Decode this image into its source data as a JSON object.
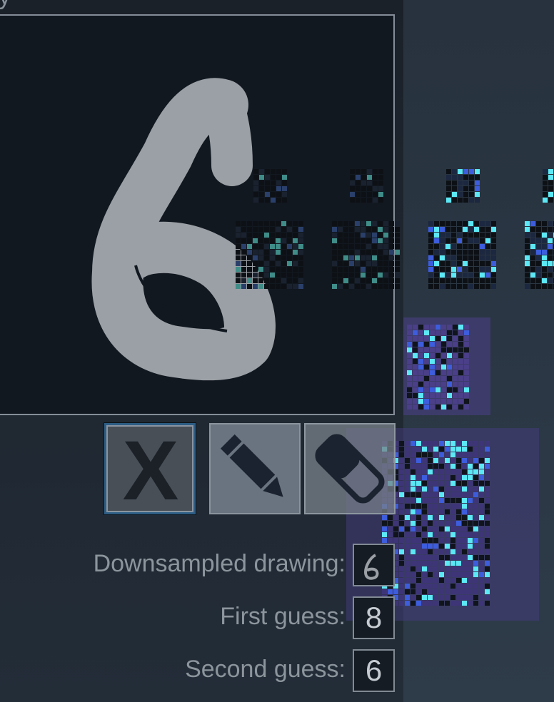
{
  "header": {
    "title_fragment": "y"
  },
  "canvas": {
    "drawn_digit": "6"
  },
  "tools": {
    "clear_label": "X",
    "pencil": "pencil-icon",
    "eraser": "eraser-icon"
  },
  "results": {
    "downsampled_label": "Downsampled drawing:",
    "first_guess_label": "First guess:",
    "first_guess_value": "8",
    "second_guess_label": "Second guess:",
    "second_guess_value": "6"
  },
  "colors": {
    "stroke": "#9ba0a6",
    "accent_cyan": "#5ce8f4",
    "accent_blue": "#3d5ddc",
    "teal": "#3f8c88",
    "purple_panel": "#4a3f88"
  }
}
